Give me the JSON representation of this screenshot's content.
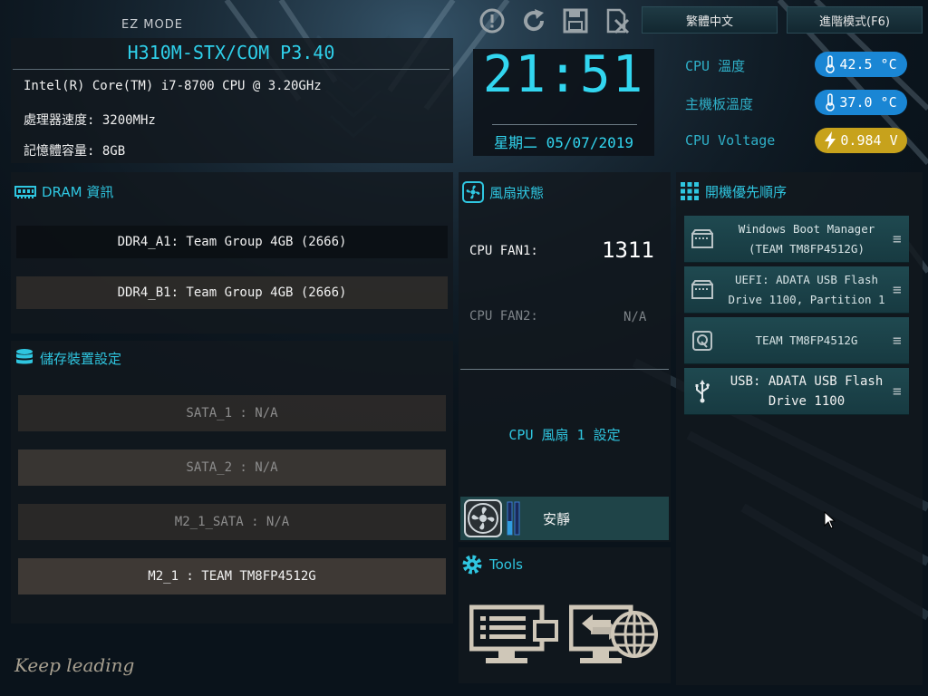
{
  "header": {
    "mode_label": "EZ MODE",
    "board_model": "H310M-STX/COM P3.40",
    "language_button": "繁體中文",
    "advanced_button": "進階模式(F6)",
    "icons": [
      "help-icon",
      "reset-icon",
      "save-icon",
      "exit-icon"
    ]
  },
  "system_info": {
    "cpu": "Intel(R) Core(TM) i7-8700 CPU @ 3.20GHz",
    "speed": "處理器速度: 3200MHz",
    "memory": "記憶體容量: 8GB"
  },
  "clock": {
    "time": "21:51",
    "date": "星期二 05/07/2019"
  },
  "status": {
    "cpu_temp_label": "CPU 溫度",
    "cpu_temp": "42.5 °C",
    "mb_temp_label": "主機板溫度",
    "mb_temp": "37.0 °C",
    "voltage_label": "CPU Voltage",
    "voltage": "0.984 V"
  },
  "dram": {
    "title": "DRAM 資訊",
    "slots": [
      "DDR4_A1: Team Group 4GB (2666)",
      "DDR4_B1: Team Group 4GB (2666)"
    ]
  },
  "storage": {
    "title": "儲存裝置設定",
    "ports": [
      "SATA_1 : N/A",
      "SATA_2 : N/A",
      "M2_1_SATA : N/A",
      "M2_1 : TEAM TM8FP4512G"
    ]
  },
  "fan": {
    "title": "風扇狀態",
    "fan1_label": "CPU FAN1:",
    "fan1_value": "1311",
    "fan2_label": "CPU FAN2:",
    "fan2_value": "N/A",
    "setting_link": "CPU 風扇 1 設定",
    "mode": "安靜"
  },
  "tools": {
    "title": "Tools"
  },
  "boot": {
    "title": "開機優先順序",
    "items": [
      {
        "line1": "Windows Boot Manager",
        "line2": "(TEAM TM8FP4512G)",
        "icon": "drive-icon"
      },
      {
        "line1": "UEFI: ADATA USB Flash",
        "line2": "Drive 1100, Partition 1",
        "icon": "drive-icon"
      },
      {
        "line1": "TEAM TM8FP4512G",
        "line2": "",
        "icon": "hdd-icon"
      },
      {
        "line1": "USB: ADATA USB Flash",
        "line2": "Drive 1100",
        "icon": "usb-icon"
      }
    ]
  },
  "slogan": "Keep leading",
  "colors": {
    "accent": "#2fc6e0",
    "temp_pill": "#1a86d4",
    "voltage_pill": "#c7a21c",
    "boot_item": "#1f4950"
  }
}
